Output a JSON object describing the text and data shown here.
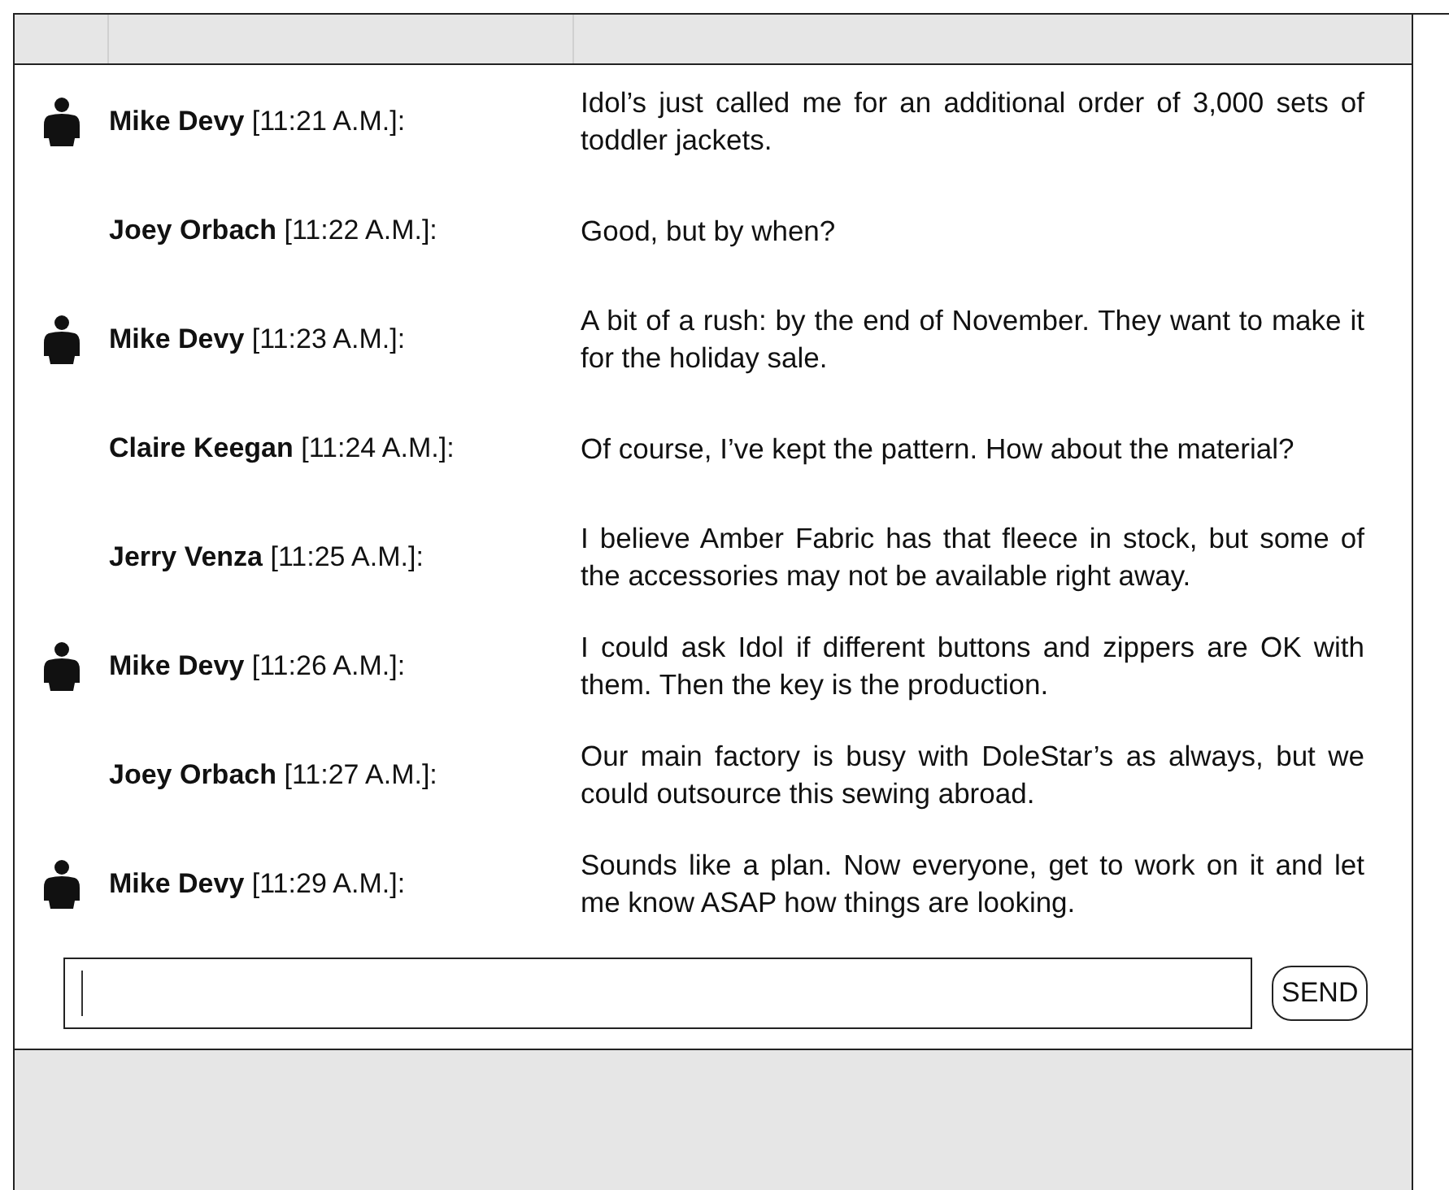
{
  "messages": [
    {
      "has_icon": true,
      "header": "**Mike Devy** [11:21 A.M.]:",
      "text": "Idol’s just called me for an additional order of 3,000 sets of toddler jackets."
    },
    {
      "has_icon": false,
      "header": "**Joey Orbach** [11:22 A.M.]:",
      "text": "Good, but by when?"
    },
    {
      "has_icon": true,
      "header": "**Mike Devy** [11:23 A.M.]:",
      "text": "A bit of a rush: by the end of November. They want to make it for the holiday sale."
    },
    {
      "has_icon": false,
      "header": "**Claire Keegan** [11:24 A.M.]:",
      "text": "Of course, I’ve kept the pattern. How about the material?"
    },
    {
      "has_icon": false,
      "header": "**Jerry Venza** [11:25 A.M.]:",
      "text": "I believe Amber Fabric has that fleece in stock, but some of the accessories may not be available right away."
    },
    {
      "has_icon": true,
      "header": "**Mike Devy** [11:26 A.M.]:",
      "text": "I could ask Idol if different buttons and zippers are OK with them. Then the key is the production."
    },
    {
      "has_icon": false,
      "header": "**Joey Orbach** [11:27 A.M.]:",
      "text": "Our main factory is busy with DoleStar’s as always, but we could outsource this sewing abroad."
    },
    {
      "has_icon": true,
      "header": "**Mike Devy** [11:29 A.M.]:",
      "text": "Sounds like a plan. Now everyone, get to work on it and let me know ASAP how things are looking."
    }
  ],
  "send_button": "SEND"
}
